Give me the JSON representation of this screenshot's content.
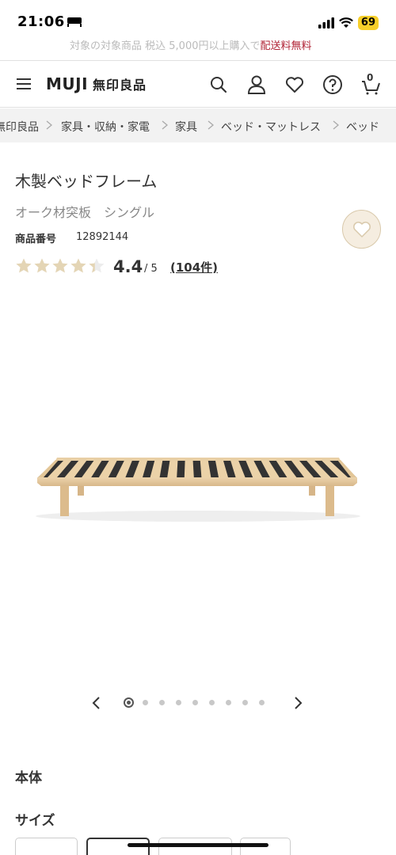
{
  "status_bar": {
    "time": "21:06",
    "battery": "69"
  },
  "promo": {
    "text_gray": "対象の対象商品 税込 5,000円以上購入で",
    "text_red": "配送料無料"
  },
  "header": {
    "logo": "MUJI",
    "logo_jp": "無印良品",
    "cart_count": "0"
  },
  "breadcrumb": [
    "無印良品",
    "家具・収納・家電",
    "家具",
    "ベッド・マットレス",
    "ベッド"
  ],
  "product": {
    "title": "木製ベッドフレーム",
    "subtitle": "オーク材突板　シングル",
    "code_label": "商品番号",
    "code": "12892144",
    "rating": "4.4",
    "rating_max": "/ 5",
    "review_count": "(104件)",
    "stars": 4.4
  },
  "carousel": {
    "total": 9,
    "active": 1
  },
  "sections": {
    "body": "本体",
    "size": "サイズ"
  },
  "colors": {
    "star": "#e4d5b5",
    "brand_red": "#b02335",
    "fav_bg": "#f5ede0"
  }
}
